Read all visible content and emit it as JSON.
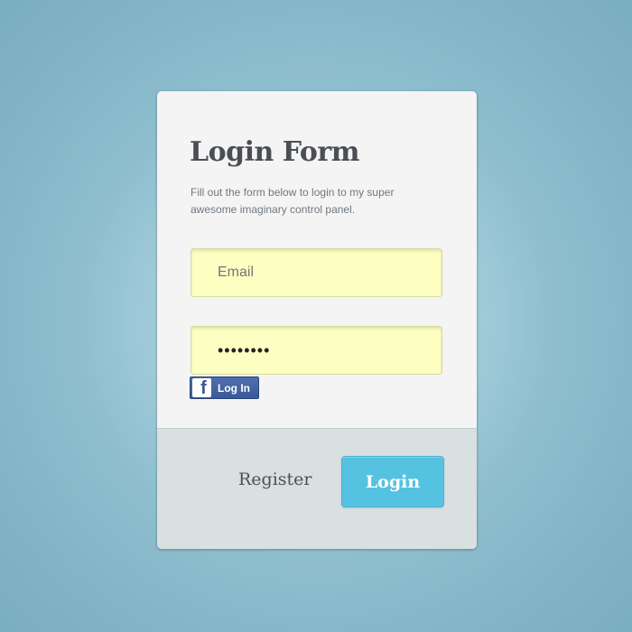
{
  "form": {
    "title": "Login Form",
    "description": "Fill out the form below to login to my super awesome imaginary control panel.",
    "email_placeholder": "Email",
    "password_value": "••••••••",
    "facebook_label": "Log In",
    "facebook_icon": "facebook-f-icon",
    "register_label": "Register",
    "login_label": "Login"
  },
  "colors": {
    "background": "#7fb2c4",
    "card": "#f4f4f4",
    "field_fill": "#fdffc2",
    "footer": "#d8e0e1",
    "login_button": "#56c2e1",
    "facebook_blue": "#3b5998"
  }
}
